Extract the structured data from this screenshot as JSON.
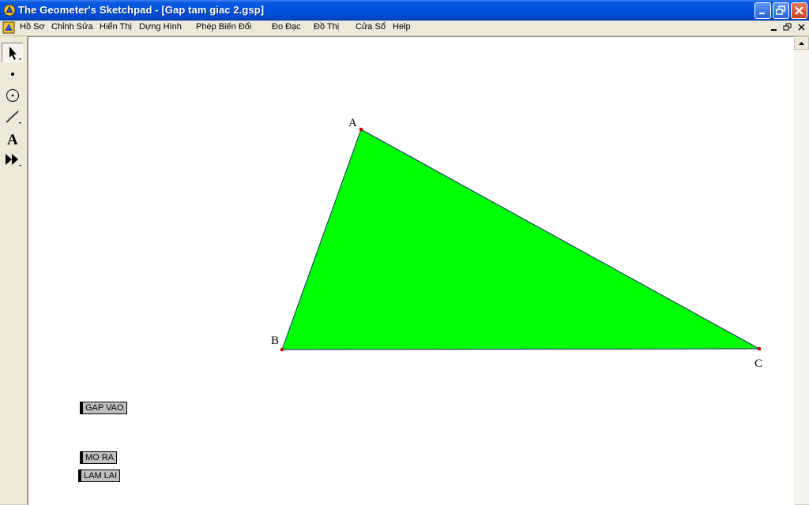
{
  "window": {
    "title": "The Geometer's Sketchpad - [Gap tam giac 2.gsp]"
  },
  "menu": {
    "items": [
      "Hồ Sơ",
      "Chỉnh Sửa",
      "Hiển Thị",
      "Dựng Hình",
      "Phép Biến Đổi",
      "Đo Đạc",
      "Đồ Thị",
      "Cửa Sổ",
      "Help"
    ]
  },
  "toolbox": {
    "tools": [
      "selection-arrow",
      "point",
      "compass",
      "straightedge",
      "text",
      "custom"
    ]
  },
  "sketch": {
    "fill_color": "#00ff00",
    "point_color": "#c00000",
    "points": [
      {
        "label": "A"
      },
      {
        "label": "B"
      },
      {
        "label": "C"
      }
    ]
  },
  "buttons": {
    "gap_vao": "GAP VAO",
    "mo_ra": "MO RA",
    "lam_lai": "LAM LAI"
  }
}
